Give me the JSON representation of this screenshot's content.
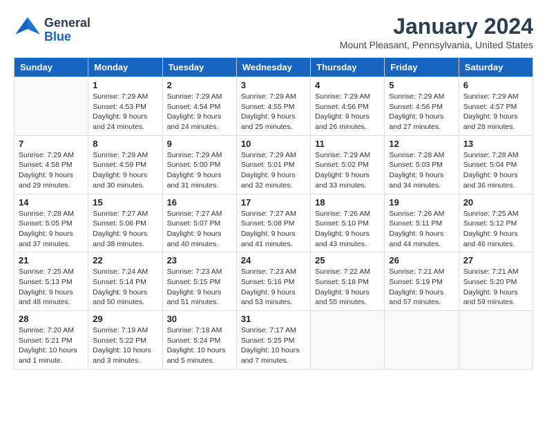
{
  "header": {
    "logo_general": "General",
    "logo_blue": "Blue",
    "month_title": "January 2024",
    "location": "Mount Pleasant, Pennsylvania, United States"
  },
  "days_of_week": [
    "Sunday",
    "Monday",
    "Tuesday",
    "Wednesday",
    "Thursday",
    "Friday",
    "Saturday"
  ],
  "weeks": [
    [
      {
        "day": "",
        "info": ""
      },
      {
        "day": "1",
        "info": "Sunrise: 7:29 AM\nSunset: 4:53 PM\nDaylight: 9 hours\nand 24 minutes."
      },
      {
        "day": "2",
        "info": "Sunrise: 7:29 AM\nSunset: 4:54 PM\nDaylight: 9 hours\nand 24 minutes."
      },
      {
        "day": "3",
        "info": "Sunrise: 7:29 AM\nSunset: 4:55 PM\nDaylight: 9 hours\nand 25 minutes."
      },
      {
        "day": "4",
        "info": "Sunrise: 7:29 AM\nSunset: 4:56 PM\nDaylight: 9 hours\nand 26 minutes."
      },
      {
        "day": "5",
        "info": "Sunrise: 7:29 AM\nSunset: 4:56 PM\nDaylight: 9 hours\nand 27 minutes."
      },
      {
        "day": "6",
        "info": "Sunrise: 7:29 AM\nSunset: 4:57 PM\nDaylight: 9 hours\nand 28 minutes."
      }
    ],
    [
      {
        "day": "7",
        "info": "Sunrise: 7:29 AM\nSunset: 4:58 PM\nDaylight: 9 hours\nand 29 minutes."
      },
      {
        "day": "8",
        "info": "Sunrise: 7:29 AM\nSunset: 4:59 PM\nDaylight: 9 hours\nand 30 minutes."
      },
      {
        "day": "9",
        "info": "Sunrise: 7:29 AM\nSunset: 5:00 PM\nDaylight: 9 hours\nand 31 minutes."
      },
      {
        "day": "10",
        "info": "Sunrise: 7:29 AM\nSunset: 5:01 PM\nDaylight: 9 hours\nand 32 minutes."
      },
      {
        "day": "11",
        "info": "Sunrise: 7:29 AM\nSunset: 5:02 PM\nDaylight: 9 hours\nand 33 minutes."
      },
      {
        "day": "12",
        "info": "Sunrise: 7:28 AM\nSunset: 5:03 PM\nDaylight: 9 hours\nand 34 minutes."
      },
      {
        "day": "13",
        "info": "Sunrise: 7:28 AM\nSunset: 5:04 PM\nDaylight: 9 hours\nand 36 minutes."
      }
    ],
    [
      {
        "day": "14",
        "info": "Sunrise: 7:28 AM\nSunset: 5:05 PM\nDaylight: 9 hours\nand 37 minutes."
      },
      {
        "day": "15",
        "info": "Sunrise: 7:27 AM\nSunset: 5:06 PM\nDaylight: 9 hours\nand 38 minutes."
      },
      {
        "day": "16",
        "info": "Sunrise: 7:27 AM\nSunset: 5:07 PM\nDaylight: 9 hours\nand 40 minutes."
      },
      {
        "day": "17",
        "info": "Sunrise: 7:27 AM\nSunset: 5:08 PM\nDaylight: 9 hours\nand 41 minutes."
      },
      {
        "day": "18",
        "info": "Sunrise: 7:26 AM\nSunset: 5:10 PM\nDaylight: 9 hours\nand 43 minutes."
      },
      {
        "day": "19",
        "info": "Sunrise: 7:26 AM\nSunset: 5:11 PM\nDaylight: 9 hours\nand 44 minutes."
      },
      {
        "day": "20",
        "info": "Sunrise: 7:25 AM\nSunset: 5:12 PM\nDaylight: 9 hours\nand 46 minutes."
      }
    ],
    [
      {
        "day": "21",
        "info": "Sunrise: 7:25 AM\nSunset: 5:13 PM\nDaylight: 9 hours\nand 48 minutes."
      },
      {
        "day": "22",
        "info": "Sunrise: 7:24 AM\nSunset: 5:14 PM\nDaylight: 9 hours\nand 50 minutes."
      },
      {
        "day": "23",
        "info": "Sunrise: 7:23 AM\nSunset: 5:15 PM\nDaylight: 9 hours\nand 51 minutes."
      },
      {
        "day": "24",
        "info": "Sunrise: 7:23 AM\nSunset: 5:16 PM\nDaylight: 9 hours\nand 53 minutes."
      },
      {
        "day": "25",
        "info": "Sunrise: 7:22 AM\nSunset: 5:18 PM\nDaylight: 9 hours\nand 55 minutes."
      },
      {
        "day": "26",
        "info": "Sunrise: 7:21 AM\nSunset: 5:19 PM\nDaylight: 9 hours\nand 57 minutes."
      },
      {
        "day": "27",
        "info": "Sunrise: 7:21 AM\nSunset: 5:20 PM\nDaylight: 9 hours\nand 59 minutes."
      }
    ],
    [
      {
        "day": "28",
        "info": "Sunrise: 7:20 AM\nSunset: 5:21 PM\nDaylight: 10 hours\nand 1 minute."
      },
      {
        "day": "29",
        "info": "Sunrise: 7:19 AM\nSunset: 5:22 PM\nDaylight: 10 hours\nand 3 minutes."
      },
      {
        "day": "30",
        "info": "Sunrise: 7:18 AM\nSunset: 5:24 PM\nDaylight: 10 hours\nand 5 minutes."
      },
      {
        "day": "31",
        "info": "Sunrise: 7:17 AM\nSunset: 5:25 PM\nDaylight: 10 hours\nand 7 minutes."
      },
      {
        "day": "",
        "info": ""
      },
      {
        "day": "",
        "info": ""
      },
      {
        "day": "",
        "info": ""
      }
    ]
  ]
}
